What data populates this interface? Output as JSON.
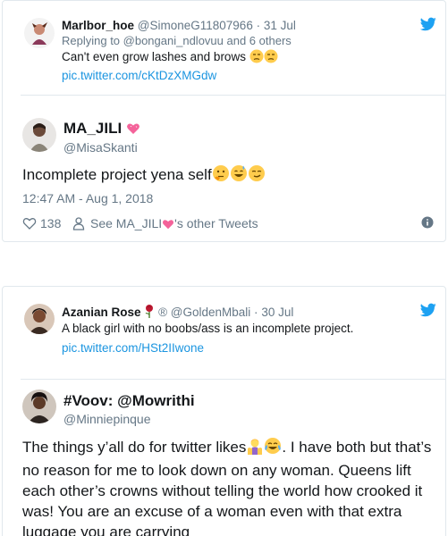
{
  "colors": {
    "text": "#14171a",
    "secondary": "#657786",
    "link": "#1b95e0",
    "twitter_blue": "#1da1f2",
    "border": "#e1e8ed"
  },
  "tweet1": {
    "quote": {
      "name": "Marlbor_hoe",
      "handle": "@SimoneG11807966",
      "separator": "·",
      "date": "31 Jul",
      "reply": "Replying to @bongani_ndlovuu and 6 others",
      "text": "Can't even grow lashes and brows",
      "text_emojis": [
        "unamused-face",
        "unamused-face"
      ],
      "link": "pic.twitter.com/cKtDzXMGdw"
    },
    "author": {
      "name": "MA_JILI",
      "name_emoji": "sparkling-heart",
      "handle": "@MisaSkanti"
    },
    "text": "Incomplete project yena self",
    "text_emojis": [
      "thinking-face",
      "grinning-sweat-face",
      "smirking-face"
    ],
    "timestamp": "12:47 AM - Aug 1, 2018",
    "likes": "138",
    "see_prefix": "See MA_JILI",
    "see_suffix": "'s other Tweets",
    "icons": [
      "heart-icon",
      "person-icon",
      "info-icon",
      "twitter-bird-icon"
    ]
  },
  "tweet2": {
    "quote": {
      "name": "Azanian Rose",
      "name_emoji": "rose",
      "registered": "®",
      "handle": "@GoldenMbali",
      "separator": "·",
      "date": "30 Jul",
      "text": "A black girl with no boobs/ass is an incomplete project.",
      "link": "pic.twitter.com/HSt2IIwone"
    },
    "author": {
      "name": "#Voov: @Mowrithi",
      "handle": "@Minniepinque"
    },
    "text_part1": "The things y’all do for twitter likes",
    "text_emojis": [
      "woman-shrugging",
      "face-with-tears-of-joy"
    ],
    "text_part2": ". I have both but that’s no reason for me to look down on any woman. Queens lift each other’s crowns without telling the world how crooked it was! You are an excuse of a woman even with that extra luggage you are carrying"
  }
}
